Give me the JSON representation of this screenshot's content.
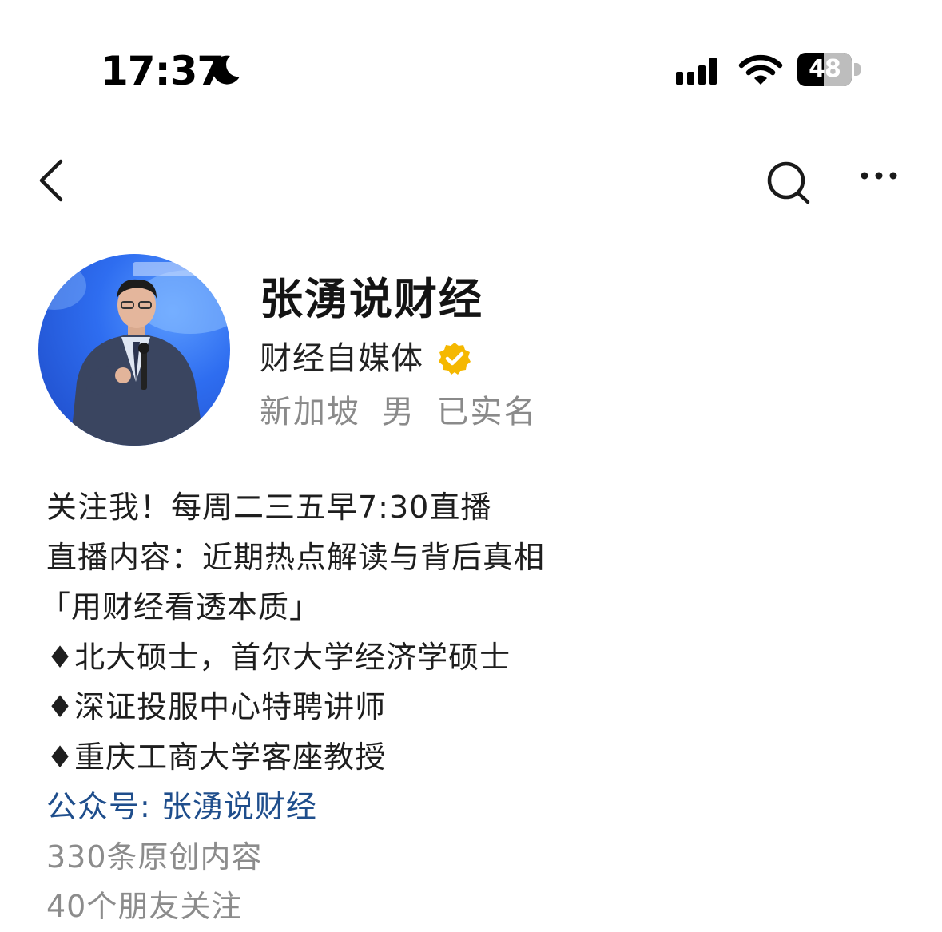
{
  "status_bar": {
    "time": "17:37",
    "battery": "48"
  },
  "nav": {
    "back": "chevron-left-icon",
    "search": "search-icon",
    "more": "more-icon"
  },
  "profile": {
    "name": "张湧说财经",
    "category": "财经自媒体",
    "verified_color": "#f5b800",
    "location": "新加坡",
    "gender": "男",
    "verification": "已实名"
  },
  "bio": {
    "lines": [
      "关注我！每周二三五早7:30直播",
      "直播内容：近期热点解读与背后真相",
      "「用财经看透本质」",
      "♦北大硕士，首尔大学经济学硕士",
      "♦深证投服中心特聘讲师",
      "♦重庆工商大学客座教授"
    ],
    "official_account": "公众号: 张湧说财经",
    "original_count": "330条原创内容",
    "friends_following": "40个朋友关注"
  },
  "colors": {
    "link": "#1f4e8c",
    "secondary_text": "#8a8a8a"
  }
}
